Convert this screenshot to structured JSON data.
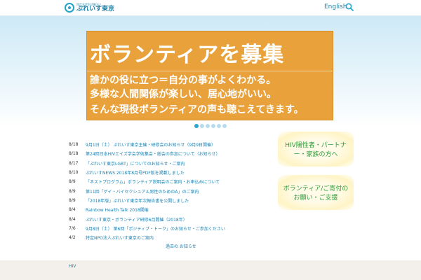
{
  "header": {
    "logo_subtitle": "特定非営利活動法人",
    "logo_title": "ぷれいす東京",
    "lang_label": "English",
    "search_icon": "search-icon"
  },
  "banner": {
    "title": "ボランティアを募集",
    "line1": "誰かの役に立つ＝自分の事がよくわかる。",
    "line2": "多様な人間関係が楽しい、居心地がいい。",
    "line3": "そんな現役ボランティアの声も聴こえてきます。",
    "background_color": "#e9a23b"
  },
  "slider": {
    "dot_count": 6,
    "active_index": 0
  },
  "news": [
    {
      "date": "8/18",
      "text": "9月1日（土） ぷれいす東京主催・研修会のお知らせ（9月9日開催）"
    },
    {
      "date": "8/18",
      "text": "第24回日本HIVエイズ学会学術集会・総会の参加について（お知らせ）"
    },
    {
      "date": "8/17",
      "text": "「ぷれいす東京LGBT」についてのお知らせ・ご案内"
    },
    {
      "date": "8/10",
      "text": "ぷれいすNEWS 2018年8月号PDF版を掲載しました"
    },
    {
      "date": "8/9",
      "text": "「ネストプログラム」ボランティア説明会のご案内・お申込みについて"
    },
    {
      "date": "8/9",
      "text": "第11回「ゲイ・バイセクシュアル男性のためのA」のご案内"
    },
    {
      "date": "8/9",
      "text": "「2018年版」ぷれいす東京年次報告書を公開しました"
    },
    {
      "date": "8/4",
      "text": "Rainbow Health Talk 2018開催"
    },
    {
      "date": "8/4",
      "text": "ぷれいす東京・ボランティア研修6月開催（2018年）"
    },
    {
      "date": "7/6",
      "text": "9月8日（土） 第6回「ポジティブ・トーク」のお知らせ・ご参加ください"
    },
    {
      "date": "4/2",
      "text": "特定NPO法人ぷれいす東京のご案内"
    }
  ],
  "more_link": "過去の お知らせ",
  "side_buttons": {
    "hiv_label": "HIV陽性者・パートナー・家族の方へ",
    "support_label": "ボランティア/ご寄付の お願い・ご支援"
  },
  "footer": {
    "label": "HIV"
  }
}
